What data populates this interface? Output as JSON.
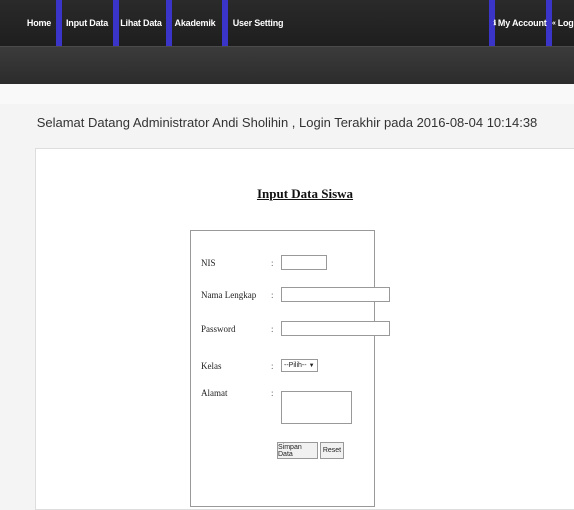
{
  "nav": {
    "items": [
      "Home",
      "Input Data",
      "Lihat Data",
      "Akademik",
      "User Setting"
    ],
    "my_account": "My Account",
    "logout": "Logout"
  },
  "welcome": "Selamat Datang Administrator Andi Sholihin , Login Terakhir pada 2016-08-04 10:14:38",
  "form": {
    "title": "Input Data Siswa",
    "labels": {
      "nis": "NIS",
      "nama": "Nama Lengkap",
      "password": "Password",
      "kelas": "Kelas",
      "alamat": "Alamat"
    },
    "colon": ":",
    "kelas_selected": "--Pilih--",
    "buttons": {
      "save": "Simpan Data",
      "reset": "Reset"
    }
  },
  "colors": {
    "nav_bg": "#222222",
    "nav_separator": "#3a35c8"
  }
}
